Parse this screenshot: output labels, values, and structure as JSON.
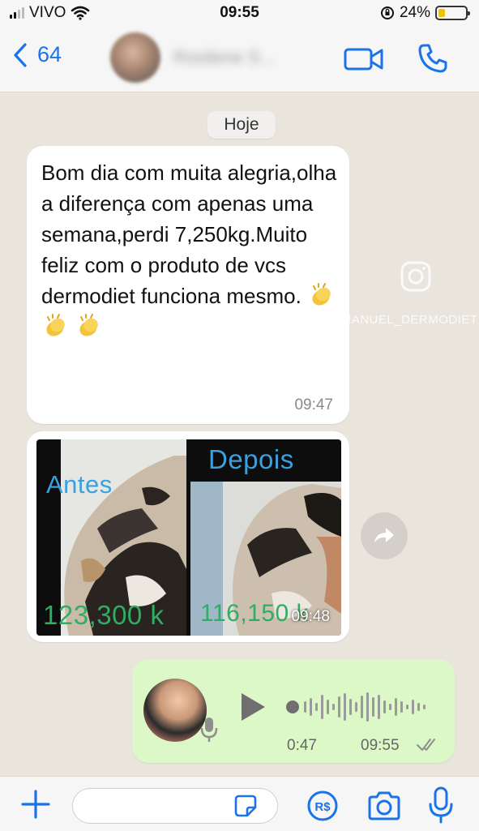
{
  "status_bar": {
    "carrier": "VIVO",
    "time": "09:55",
    "battery_percent": "24%",
    "battery_level": 0.24
  },
  "header": {
    "back_count": "64",
    "contact_name": "Rosilene S..."
  },
  "date_chip": "Hoje",
  "messages": {
    "text": {
      "body": "Bom dia com muita alegria,olha a diferença com apenas uma semana,perdi 7,250kg.Muito feliz com o produto de vcs dermodiet funciona mesmo.",
      "time": "09:47"
    },
    "image": {
      "label_before": "Antes",
      "label_after": "Depois",
      "weight_before": "123,300 k",
      "weight_after": "116,150 k",
      "time": "09:48"
    },
    "audio": {
      "duration": "0:47",
      "time": "09:55"
    }
  },
  "watermark": {
    "handle": "@MANUEL_DERMODIET"
  },
  "colors": {
    "accent": "#1a73e8",
    "outgoing_bubble": "#dcf8c6",
    "chat_bg": "#e9e4dc"
  },
  "icons": [
    "wifi-icon",
    "battery-icon",
    "back-chevron-icon",
    "video-call-icon",
    "phone-icon",
    "clap-emoji-icon",
    "forward-icon",
    "instagram-icon",
    "play-icon",
    "mic-icon",
    "double-check-icon",
    "plus-icon",
    "sticker-icon",
    "payment-icon",
    "camera-icon"
  ]
}
